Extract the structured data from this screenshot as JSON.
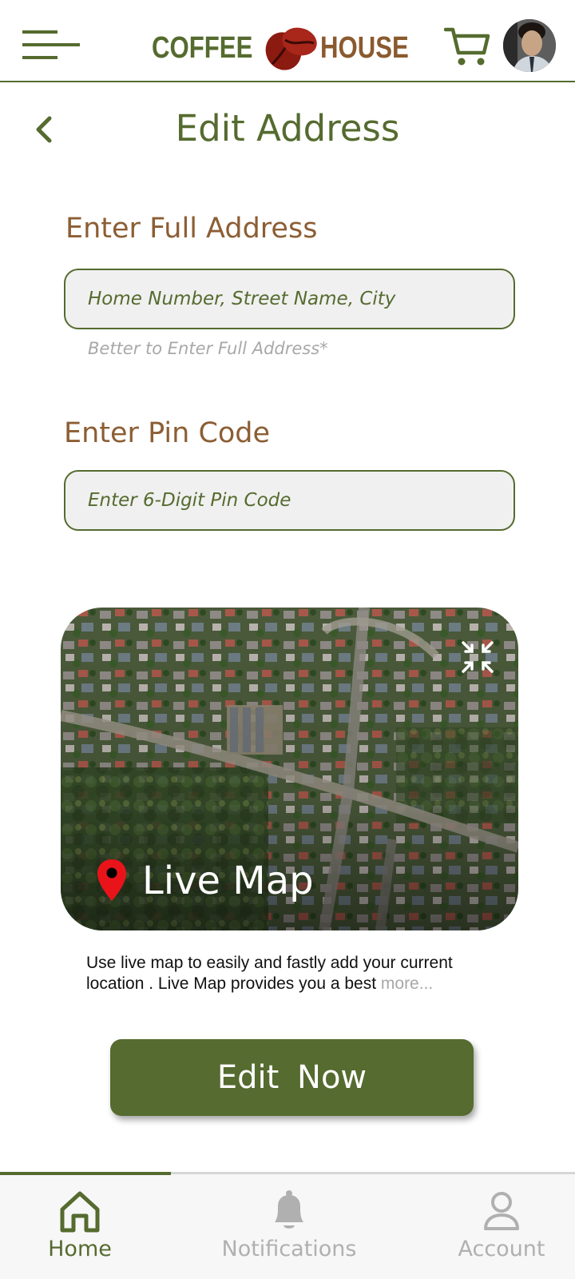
{
  "header": {
    "logo_left": "COFFEE",
    "logo_right": "HOUSE",
    "icons": {
      "menu": "hamburger-menu-icon",
      "cart": "shopping-cart-icon",
      "avatar": "user-avatar"
    }
  },
  "page": {
    "title": "Edit Address",
    "back_icon": "chevron-left-icon"
  },
  "form": {
    "address_label": "Enter Full Address",
    "address_placeholder": "Home Number, Street Name, City",
    "address_value": "",
    "address_hint": "Better to Enter Full Address*",
    "pin_label": "Enter Pin Code",
    "pin_placeholder": "Enter 6-Digit Pin Code",
    "pin_value": ""
  },
  "map": {
    "label": "Live Map",
    "icons": {
      "expand": "expand-icon",
      "pin": "location-pin-icon"
    },
    "description": "Use live map to easily and fastly add your current location . Live Map provides you a  best",
    "more": "more..."
  },
  "actions": {
    "edit_label": "Edit  Now"
  },
  "bottom_nav": {
    "items": [
      {
        "label": "Home",
        "icon": "home-icon",
        "active": true
      },
      {
        "label": "Notifications",
        "icon": "bell-icon",
        "active": false
      },
      {
        "label": "Account",
        "icon": "user-icon",
        "active": false
      }
    ]
  },
  "colors": {
    "primary_green": "#556b2f",
    "brown": "#8c5e34",
    "inactive": "#b0b0b0",
    "pin_red": "#e8141a"
  }
}
